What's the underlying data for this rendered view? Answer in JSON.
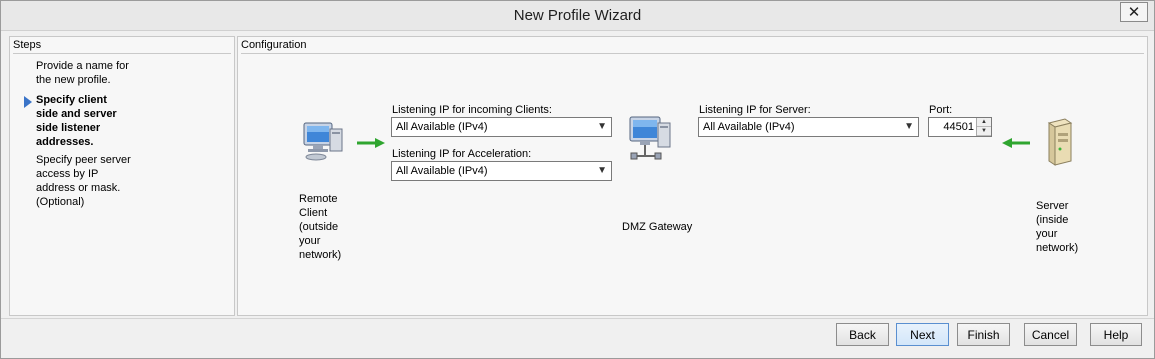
{
  "window": {
    "title": "New Profile Wizard",
    "close_glyph": "✕"
  },
  "steps": {
    "header": "Steps",
    "items": [
      {
        "lines": [
          "Provide a name for",
          "the new profile."
        ]
      },
      {
        "lines": [
          "Specify client",
          "side and server",
          "side listener",
          "addresses."
        ],
        "current": true
      },
      {
        "lines": [
          "Specify peer server",
          "access by IP",
          "address or mask.",
          "(Optional)"
        ]
      }
    ]
  },
  "config": {
    "header": "Configuration",
    "remote_client_label": [
      "Remote",
      "Client",
      "(outside",
      "your",
      "network)"
    ],
    "incoming_label": "Listening IP for incoming Clients:",
    "incoming_value": "All Available (IPv4)",
    "acceleration_label": "Listening IP for Acceleration:",
    "acceleration_value": "All Available (IPv4)",
    "gateway_label": "DMZ Gateway",
    "server_ip_label": "Listening IP for Server:",
    "server_ip_value": "All Available (IPv4)",
    "port_label": "Port:",
    "port_value": "44501",
    "server_label": [
      "Server",
      "(inside",
      "your",
      "network)"
    ]
  },
  "buttons": {
    "back": "Back",
    "next": "Next",
    "finish": "Finish",
    "cancel": "Cancel",
    "help": "Help"
  },
  "icons": {
    "client": "computer-icon",
    "gateway": "network-computer-icon",
    "server": "server-tower-icon",
    "arrow_color": "#2fa52f"
  }
}
